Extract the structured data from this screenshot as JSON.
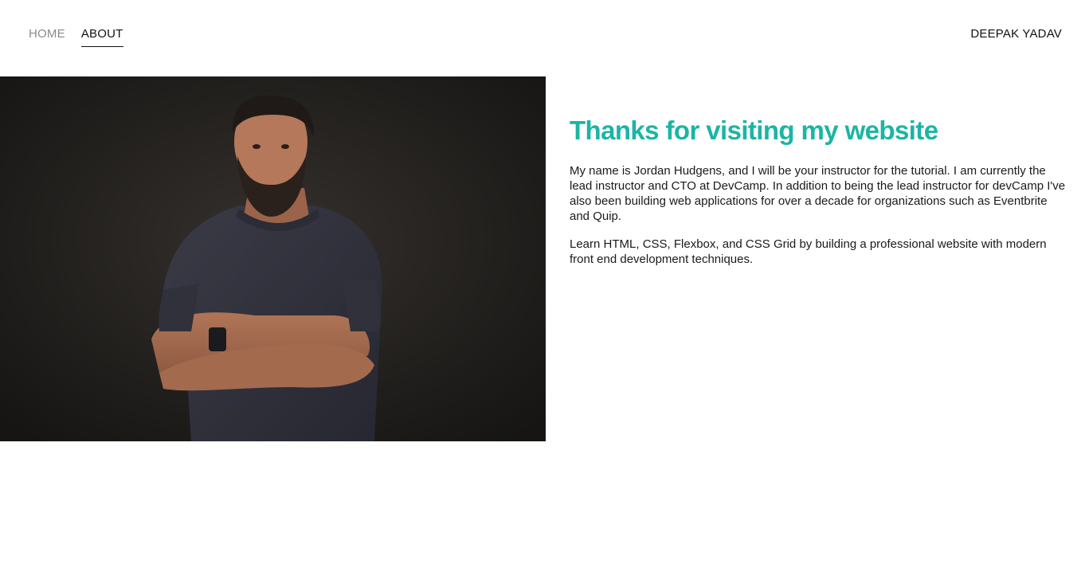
{
  "header": {
    "nav": [
      {
        "label": "HOME",
        "active": false
      },
      {
        "label": "ABOUT",
        "active": true
      }
    ],
    "brand": "DEEPAK YADAV"
  },
  "photo": {
    "description_icon": "portrait-photo"
  },
  "main": {
    "heading": "Thanks for visiting my website",
    "paragraphs": [
      "My name is Jordan Hudgens, and I will be your instructor for the tutorial. I am currently the lead instructor and CTO at DevCamp. In addition to being the lead instructor for devCamp I've also been building web applications for over a decade for organizations such as Eventbrite and Quip.",
      "Learn HTML, CSS, Flexbox, and CSS Grid by building a professional website with modern front end development techniques."
    ]
  },
  "colors": {
    "accent": "#1bb5a4",
    "text": "#1a1a1a",
    "nav_inactive": "#8a8a8a"
  }
}
